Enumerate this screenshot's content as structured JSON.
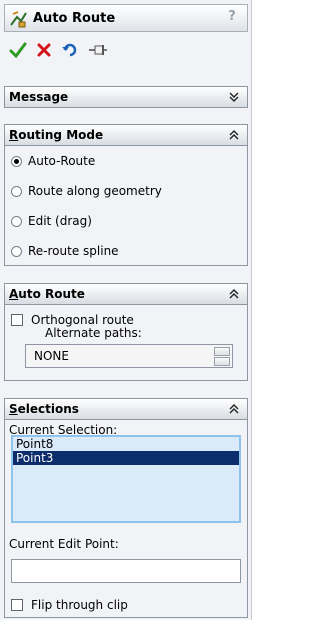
{
  "header": {
    "title": "Auto Route",
    "help": "?",
    "icon": "auto-route-icon"
  },
  "toolbar": {
    "icons": [
      "ok-check-icon",
      "cancel-x-icon",
      "undo-icon",
      "pushpin-icon"
    ]
  },
  "message": {
    "title": "Message"
  },
  "routing_mode": {
    "title_u": "R",
    "title_rest": "outing Mode",
    "options": [
      {
        "label": "Auto-Route",
        "selected": true
      },
      {
        "label": "Route along geometry",
        "selected": false
      },
      {
        "label": "Edit (drag)",
        "selected": false
      },
      {
        "label": "Re-route spline",
        "selected": false
      }
    ]
  },
  "auto_route": {
    "title_u": "A",
    "title_rest": "uto Route",
    "orthogonal_label": "Orthogonal route",
    "orthogonal_checked": false,
    "alternate_label": "Alternate paths:",
    "alternate_value": "NONE"
  },
  "selections": {
    "title_u": "S",
    "title_rest": "elections",
    "current_selection_label": "Current Selection:",
    "items": [
      {
        "label": "Point8",
        "selected": false
      },
      {
        "label": "Point3",
        "selected": true
      }
    ],
    "current_edit_label": "Current Edit Point:",
    "current_edit_value": "",
    "flip_label": "Flip through clip",
    "flip_checked": false
  }
}
